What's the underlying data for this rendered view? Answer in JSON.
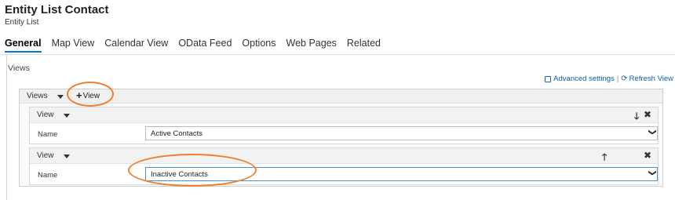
{
  "header": {
    "title": "Entity List Contact",
    "subtitle": "Entity List"
  },
  "tabs": [
    {
      "label": "General",
      "active": true
    },
    {
      "label": "Map View",
      "active": false
    },
    {
      "label": "Calendar View",
      "active": false
    },
    {
      "label": "OData Feed",
      "active": false
    },
    {
      "label": "Options",
      "active": false
    },
    {
      "label": "Web Pages",
      "active": false
    },
    {
      "label": "Related",
      "active": false
    }
  ],
  "section": {
    "title": "Views",
    "advanced_settings_label": "Advanced settings",
    "separator": "|",
    "refresh_view_label": "Refresh View"
  },
  "views_panel": {
    "label": "Views",
    "add_view_label": "View",
    "add_view_glyph": "+",
    "blocks": [
      {
        "title": "View",
        "name_label": "Name",
        "value": "Active Contacts",
        "move_glyph": "🡓",
        "close_glyph": "✖"
      },
      {
        "title": "View",
        "name_label": "Name",
        "value": "Inactive Contacts",
        "move_glyph": "🡑",
        "close_glyph": "✖"
      }
    ],
    "select_arrow_glyph": "❯"
  },
  "icons": {
    "advanced_settings": "checkbox-square-icon",
    "refresh": "refresh-icon",
    "dropdown": "caret-down-icon"
  },
  "colors": {
    "accent": "#0078d4",
    "link": "#0b5fa5",
    "annotation": "#f07e2e"
  }
}
